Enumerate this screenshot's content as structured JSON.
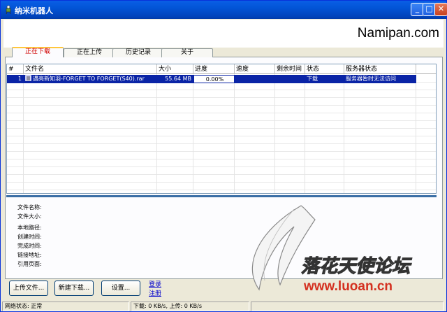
{
  "window": {
    "title": "纳米机器人",
    "buttons": {
      "minimize": "_",
      "maximize": "□",
      "close": "✕"
    }
  },
  "banner": {
    "brand": "Namipan.com"
  },
  "tabs": [
    {
      "label": "正在下载",
      "active": true
    },
    {
      "label": "正在上传",
      "active": false
    },
    {
      "label": "历史记录",
      "active": false
    },
    {
      "label": "关于",
      "active": false
    }
  ],
  "table": {
    "columns": [
      "#",
      "文件名",
      "大小",
      "进度",
      "速度",
      "剩余时间",
      "状态",
      "服务器状态"
    ],
    "rows": [
      {
        "index": "1",
        "filename": "遇亮新知羽-FORGET TO FORGET(S40).rar",
        "size": "55.64 MB",
        "progress": "0.00%",
        "progress_fraction": 0.0,
        "speed": "",
        "remaining": "",
        "status": "下载",
        "server_status": "服务器暂时无法访问",
        "selected": true
      }
    ]
  },
  "details": {
    "labels": [
      "文件名称:",
      "文件大小:",
      "本地路径:",
      "创建时间:",
      "完成时间:",
      "链接地址:",
      "引用页面:"
    ]
  },
  "actions": {
    "upload": "上传文件...",
    "new_download": "新建下载...",
    "settings": "设置...",
    "login": "登录",
    "register": "注册"
  },
  "statusbar": {
    "network": "网络状态: 正常",
    "speed": "下载: 0 KB/s, 上传: 0 KB/s",
    "extra": ""
  },
  "watermark": {
    "text": "落花天使论坛",
    "url": "www.luoan.cn"
  },
  "colors": {
    "title_bar": "#0254d6",
    "selection": "#0a24a6",
    "active_tab_text": "#d00000",
    "watermark_red": "#d4301f"
  }
}
